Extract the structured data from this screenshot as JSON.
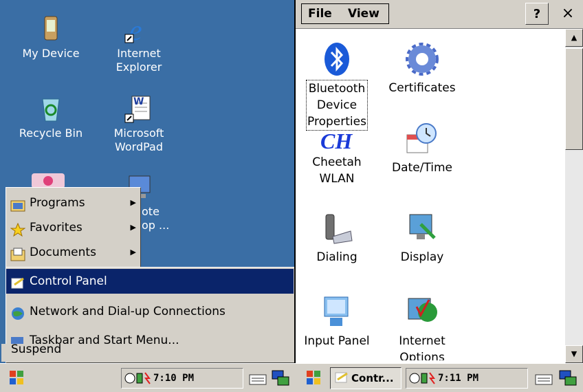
{
  "left": {
    "desktop_icons": [
      {
        "label": "My Device",
        "icon": "my-device-icon"
      },
      {
        "label": "Internet\nExplorer",
        "icon": "internet-explorer-icon"
      },
      {
        "label": "Recycle Bin",
        "icon": "recycle-bin-icon"
      },
      {
        "label": "Microsoft\nWordPad",
        "icon": "wordpad-icon"
      },
      {
        "label": "ote\nop ...",
        "icon": "remote-desktop-icon"
      }
    ],
    "start_menu": {
      "submenus": [
        {
          "label": "Programs",
          "mnemonic": "P"
        },
        {
          "label": "Favorites",
          "mnemonic": "a"
        },
        {
          "label": "Documents",
          "mnemonic": "D"
        }
      ],
      "settings_items": [
        {
          "label": "Control Panel",
          "mnemonic": "C"
        },
        {
          "label": "Network and Dial-up Connections",
          "mnemonic": "N"
        },
        {
          "label": "Taskbar and Start Menu...",
          "mnemonic": "T"
        }
      ],
      "hidden_item": "Suspend"
    },
    "taskbar": {
      "time": "7:10 PM"
    }
  },
  "right": {
    "menu": {
      "file": "File",
      "view": "View",
      "help_btn": "?",
      "close_btn": "×"
    },
    "control_panel_items": [
      {
        "label": "Bluetooth\nDevice\nProperties",
        "icon": "bluetooth-icon"
      },
      {
        "label": "Certificates",
        "icon": "certificates-gear-icon"
      },
      {
        "label": "Cheetah\nWLAN",
        "icon": "cheetah-wlan-icon"
      },
      {
        "label": "Date/Time",
        "icon": "date-time-icon"
      },
      {
        "label": "Dialing",
        "icon": "dialing-icon"
      },
      {
        "label": "Display",
        "icon": "display-icon"
      },
      {
        "label": "Input Panel",
        "icon": "input-panel-icon"
      },
      {
        "label": "Internet\nOptions",
        "icon": "internet-options-icon"
      }
    ],
    "taskbar": {
      "task_label": "Contr...",
      "time": "7:11 PM"
    }
  },
  "colors": {
    "desktop": "#3a6ea5",
    "selection": "#0a246a",
    "chrome": "#d4d0c8"
  }
}
